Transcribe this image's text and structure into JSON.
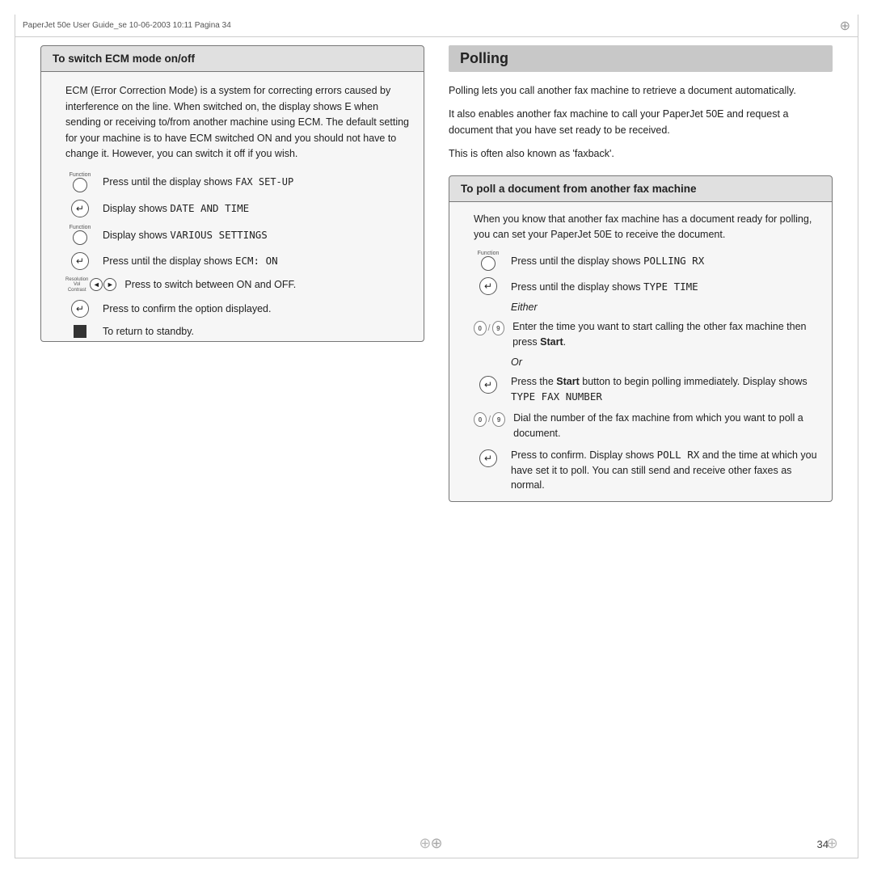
{
  "header": {
    "text": "PaperJet 50e User Guide_se   10-06-2003   10:11   Pagina 34"
  },
  "left": {
    "box_title": "To switch ECM mode on/off",
    "box_body": "ECM (Error Correction Mode) is a system for correcting errors caused by interference on the line. When switched on, the display shows E when sending or receiving to/from another machine using ECM. The default setting for your machine is to have ECM switched ON and you should not have to change it. However, you can switch it off if you wish.",
    "steps": [
      {
        "icon": "function",
        "text_prefix": "Press until the display shows ",
        "mono": "FAX SET-UP",
        "text_suffix": ""
      },
      {
        "icon": "enter",
        "text_prefix": "Display shows ",
        "mono": "DATE AND TIME",
        "text_suffix": ""
      },
      {
        "icon": "function",
        "text_prefix": "Display shows ",
        "mono": "VARIOUS SETTINGS",
        "text_suffix": ""
      },
      {
        "icon": "enter",
        "text_prefix": "Press until the display shows ",
        "mono": "ECM: ON",
        "text_suffix": ""
      },
      {
        "icon": "nav",
        "text_prefix": "Press to switch between ON and OFF.",
        "mono": "",
        "text_suffix": ""
      },
      {
        "icon": "enter",
        "text_prefix": "Press to confirm the option displayed.",
        "mono": "",
        "text_suffix": ""
      },
      {
        "icon": "stop",
        "text_prefix": "To return to standby.",
        "mono": "",
        "text_suffix": ""
      }
    ]
  },
  "right": {
    "section_title": "Polling",
    "intro1": "Polling lets you call another fax machine to retrieve a document automatically.",
    "intro2": "It also enables another fax machine to call your PaperJet 50E and request a document that you have set ready to be received.",
    "intro3": "This is often also known as 'faxback'.",
    "box_title": "To poll a document from another fax machine",
    "poll_intro": "When you know that another fax machine has a document ready for polling, you can set your PaperJet 50E to receive the document.",
    "steps": [
      {
        "icon": "function",
        "text": "Press until the display shows ",
        "mono": "POLLING RX",
        "suffix": ""
      },
      {
        "icon": "enter",
        "text": "Press until the display shows ",
        "mono": "TYPE TIME",
        "suffix": ""
      },
      {
        "icon": "either",
        "text": "Either",
        "mono": "",
        "suffix": ""
      },
      {
        "icon": "numpad",
        "text": "Enter the time you want to start calling the other fax machine then press ",
        "bold": "Start",
        "suffix": "."
      },
      {
        "icon": "or",
        "text": "Or",
        "mono": "",
        "suffix": ""
      },
      {
        "icon": "enter",
        "text": "Press the ",
        "bold": "Start",
        "text2": " button to begin polling immediately. Display shows ",
        "mono": "TYPE FAX NUMBER",
        "suffix": ""
      },
      {
        "icon": "numpad",
        "text": "Dial the number of the fax machine from which you want to poll a document.",
        "mono": "",
        "suffix": ""
      },
      {
        "icon": "enter",
        "text": "Press to confirm. Display shows ",
        "mono": "POLL RX",
        "suffix": " and the time at which you have set it to poll. You can still send and receive other faxes as normal."
      }
    ]
  },
  "page_number": "34"
}
